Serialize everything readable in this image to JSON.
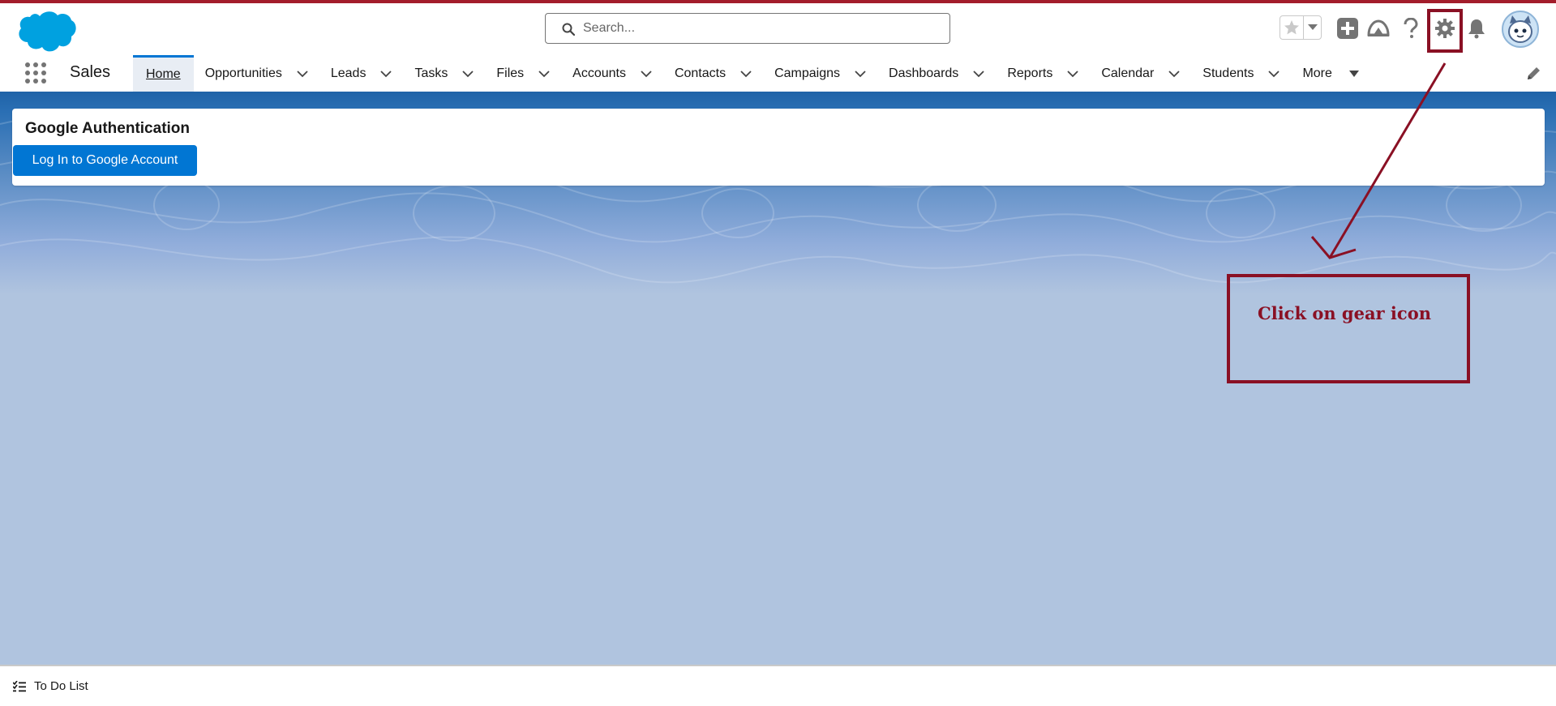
{
  "header": {
    "search": {
      "placeholder": "Search..."
    },
    "icons": [
      "favorites-star-icon",
      "favorites-dropdown-icon",
      "global-actions-plus-icon",
      "trailhead-icon",
      "help-icon",
      "setup-gear-icon",
      "notifications-bell-icon",
      "user-avatar"
    ]
  },
  "nav": {
    "app_name": "Sales",
    "items": [
      {
        "label": "Home",
        "active": true,
        "has_menu": false
      },
      {
        "label": "Opportunities",
        "has_menu": true
      },
      {
        "label": "Leads",
        "has_menu": true
      },
      {
        "label": "Tasks",
        "has_menu": true
      },
      {
        "label": "Files",
        "has_menu": true
      },
      {
        "label": "Accounts",
        "has_menu": true
      },
      {
        "label": "Contacts",
        "has_menu": true
      },
      {
        "label": "Campaigns",
        "has_menu": true
      },
      {
        "label": "Dashboards",
        "has_menu": true
      },
      {
        "label": "Reports",
        "has_menu": true
      },
      {
        "label": "Calendar",
        "has_menu": true
      },
      {
        "label": "Students",
        "has_menu": true
      },
      {
        "label": "More",
        "has_menu": true
      }
    ]
  },
  "card": {
    "title": "Google Authentication",
    "button_label": "Log In to Google Account"
  },
  "annotation": {
    "text": "Click on gear icon",
    "color": "#8a1024"
  },
  "footer": {
    "todo_label": "To Do List"
  },
  "colors": {
    "brand_blue": "#0176d3",
    "top_rule": "#a31d2b",
    "background": "#b0c4df"
  }
}
